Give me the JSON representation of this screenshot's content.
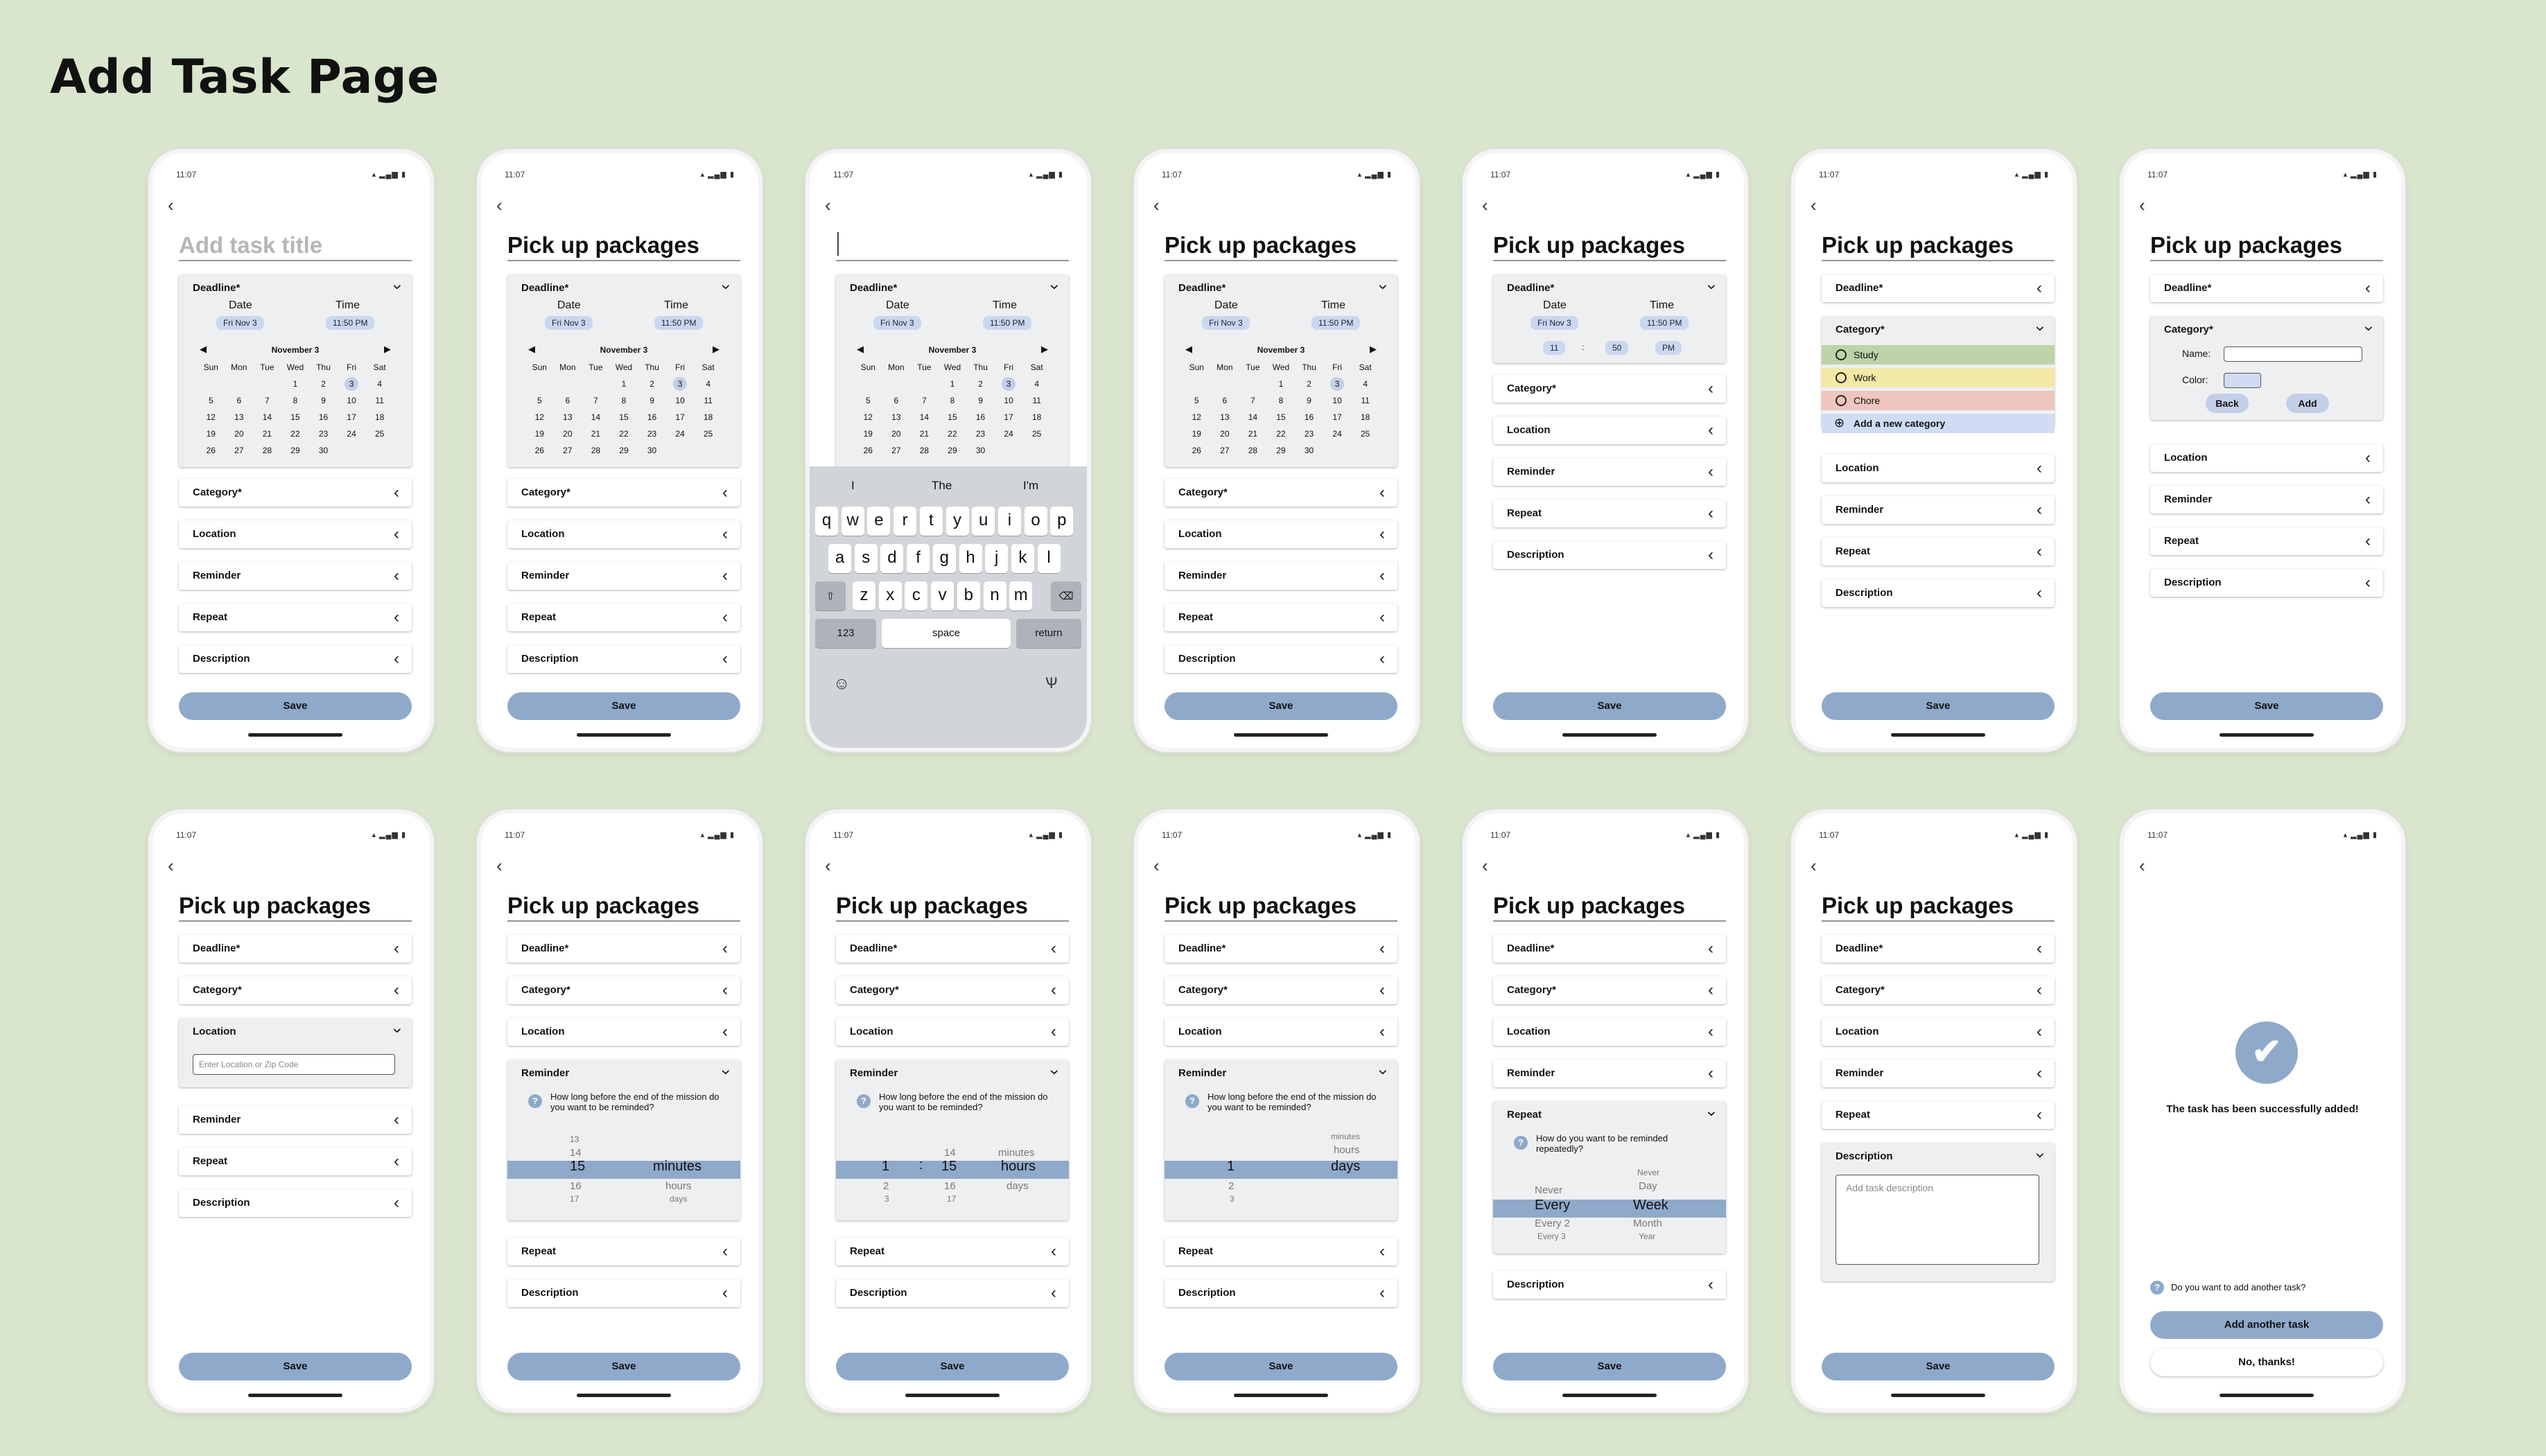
{
  "page_title": "Add Task Page",
  "status": {
    "time": "11:07",
    "icons": "▴ ▂▄▆ ▮"
  },
  "task": {
    "placeholder": "Add task title",
    "title": "Pick up packages"
  },
  "labels": {
    "deadline": "Deadline*",
    "category": "Category*",
    "location": "Location",
    "reminder": "Reminder",
    "repeat": "Repeat",
    "description": "Description",
    "save": "Save",
    "date": "Date",
    "time": "Time"
  },
  "deadline_values": {
    "date": "Fri Nov 3",
    "time": "11:50 PM",
    "hour": "11",
    "sep": ":",
    "minute": "50",
    "ampm": "PM"
  },
  "calendar": {
    "month": "November 3",
    "weekdays": [
      "Sun",
      "Mon",
      "Tue",
      "Wed",
      "Thu",
      "Fri",
      "Sat"
    ],
    "weeks": [
      [
        "",
        "",
        "",
        "1",
        "2",
        "3",
        "4"
      ],
      [
        "5",
        "6",
        "7",
        "8",
        "9",
        "10",
        "11"
      ],
      [
        "12",
        "13",
        "14",
        "15",
        "16",
        "17",
        "18"
      ],
      [
        "19",
        "20",
        "21",
        "22",
        "23",
        "24",
        "25"
      ],
      [
        "26",
        "27",
        "28",
        "29",
        "30",
        "",
        ""
      ]
    ],
    "selected": "3"
  },
  "keyboard": {
    "suggestions": [
      "I",
      "The",
      "I'm"
    ],
    "row1": [
      "q",
      "w",
      "e",
      "r",
      "t",
      "y",
      "u",
      "i",
      "o",
      "p"
    ],
    "row2": [
      "a",
      "s",
      "d",
      "f",
      "g",
      "h",
      "j",
      "k",
      "l"
    ],
    "row3": [
      "z",
      "x",
      "c",
      "v",
      "b",
      "n",
      "m"
    ],
    "numbers": "123",
    "space": "space",
    "return": "return"
  },
  "categories": {
    "items": [
      {
        "name": "Study",
        "color": "#bcd4a8"
      },
      {
        "name": "Work",
        "color": "#f3e8a6"
      },
      {
        "name": "Chore",
        "color": "#eec5bf"
      }
    ],
    "add_new": "Add a new category",
    "add_new_color": "#cfdcf3",
    "name_label": "Name:",
    "color_label": "Color:",
    "back": "Back",
    "add": "Add"
  },
  "location_placeholder": "Enter Location or Zip Code",
  "reminder": {
    "question": "How long before the end of the mission do you want to be reminded?",
    "s9": {
      "n": [
        "13",
        "14",
        "15",
        "16",
        "17"
      ],
      "u": [
        "minutes",
        "hours",
        "days"
      ]
    },
    "s10": {
      "h": [
        "1",
        "2",
        "3"
      ],
      "sep": ":",
      "m": [
        "14",
        "15",
        "16",
        "17"
      ],
      "u": [
        "minutes",
        "hours",
        "days"
      ]
    },
    "s11": {
      "h": [
        "1",
        "2",
        "3"
      ],
      "u": [
        "minutes",
        "hours",
        "days"
      ]
    }
  },
  "repeat": {
    "question": "How do you want to be reminded repeatedly?",
    "left": [
      "Never",
      "Every",
      "Every 2",
      "Every 3"
    ],
    "right": [
      "Never",
      "Day",
      "Week",
      "Month",
      "Year"
    ]
  },
  "description_placeholder": "Add task description",
  "success": {
    "message": "The task has been successfully added!",
    "question": "Do you want to add another task?",
    "add_another": "Add another task",
    "no_thanks": "No, thanks!"
  }
}
